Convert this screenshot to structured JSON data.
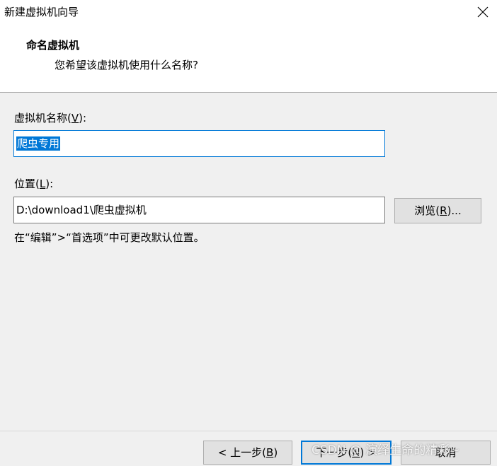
{
  "window": {
    "title": "新建虚拟机向导",
    "close_icon": "close-icon"
  },
  "header": {
    "heading": "命名虚拟机",
    "description": "您希望该虚拟机使用什么名称?"
  },
  "vm_name": {
    "label_text": "虚拟机名称(",
    "label_key": "V",
    "label_suffix": "):",
    "value": "爬虫专用"
  },
  "location": {
    "label_text": "位置(",
    "label_key": "L",
    "label_suffix": "):",
    "value": "D:\\download1\\爬虫虚拟机",
    "browse_text": "浏览(",
    "browse_key": "R",
    "browse_suffix": ")..."
  },
  "hint": "在“编辑”>“首选项”中可更改默认位置。",
  "footer": {
    "back_text": "< 上一步(",
    "back_key": "B",
    "back_suffix": ")",
    "next_text": "下一步(",
    "next_key": "N",
    "next_suffix": ") >",
    "cancel_label": "取消"
  },
  "watermark": "CSDN @ 演绎生命的精彩~",
  "colors": {
    "accent": "#0078d7",
    "selection": "#0078d7",
    "button_face": "#e1e1e1",
    "panel": "#f0f0f0"
  }
}
